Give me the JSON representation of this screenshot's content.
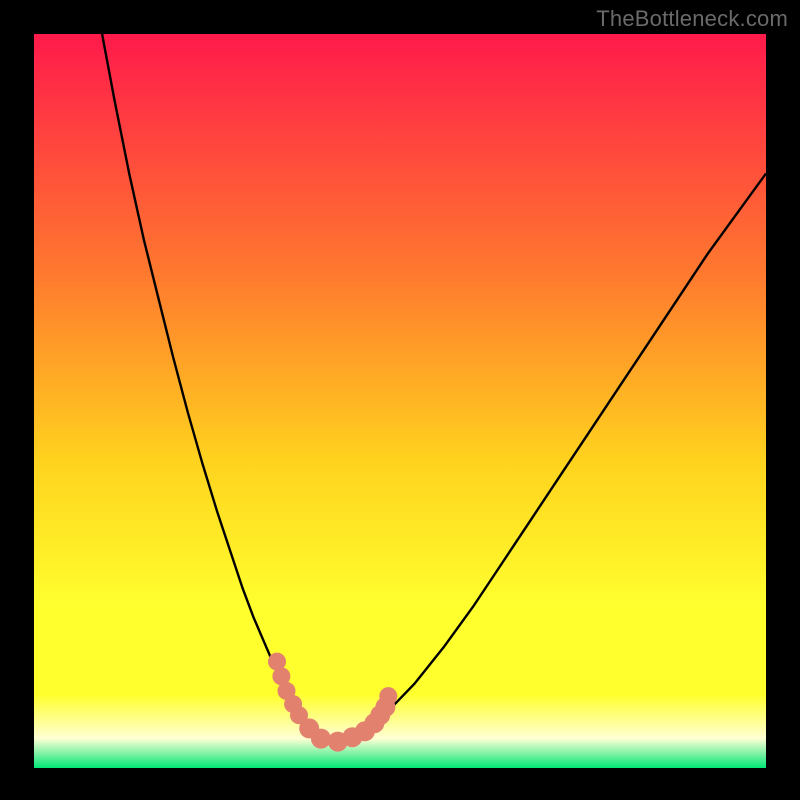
{
  "watermark": "TheBottleneck.com",
  "colors": {
    "background_frame": "#000000",
    "gradient_top": "#ff1a4b",
    "gradient_mid1": "#ff7a2e",
    "gradient_mid2": "#ffd21e",
    "gradient_mid3": "#ffff2e",
    "gradient_pale": "#feffd4",
    "gradient_bottom": "#00e676",
    "curve_stroke": "#000000",
    "marker_fill": "#e3816f"
  },
  "chart_data": {
    "type": "line",
    "title": "",
    "xlabel": "",
    "ylabel": "",
    "xlim": [
      0,
      100
    ],
    "ylim": [
      0,
      100
    ],
    "grid": false,
    "legend": false,
    "series": [
      {
        "name": "left-curve",
        "x": [
          9.3,
          11,
          13,
          15,
          17,
          19,
          21,
          23,
          25,
          27,
          28.5,
          30,
          31.5,
          33,
          34.5,
          36,
          37,
          38,
          39,
          39.5
        ],
        "y": [
          100,
          91,
          81,
          72,
          64,
          56,
          48.5,
          41.5,
          35,
          29,
          24.5,
          20.5,
          17,
          13.5,
          10.5,
          8,
          6.3,
          5,
          4,
          3.6
        ]
      },
      {
        "name": "right-curve",
        "x": [
          39.5,
          41,
          43,
          45,
          47,
          49,
          52,
          56,
          60,
          64,
          68,
          72,
          76,
          80,
          84,
          88,
          92,
          96,
          100
        ],
        "y": [
          3.6,
          3.7,
          4.2,
          5.2,
          6.6,
          8.4,
          11.5,
          16.5,
          22,
          28,
          34,
          40,
          46,
          52,
          58,
          64,
          70,
          75.5,
          81
        ]
      }
    ],
    "markers": {
      "name": "highlighted-points",
      "x": [
        33.2,
        33.8,
        34.5,
        35.4,
        36.2,
        37.6,
        39.2,
        41.5,
        43.5,
        45.2,
        46.5,
        47.3,
        48.0,
        48.4
      ],
      "y": [
        14.5,
        12.5,
        10.5,
        8.7,
        7.2,
        5.4,
        4.0,
        3.6,
        4.2,
        5.0,
        6.1,
        7.2,
        8.3,
        9.8
      ],
      "r": [
        9,
        9,
        9,
        9,
        9,
        10,
        10,
        10,
        10,
        10,
        10,
        10,
        10,
        9
      ]
    }
  }
}
